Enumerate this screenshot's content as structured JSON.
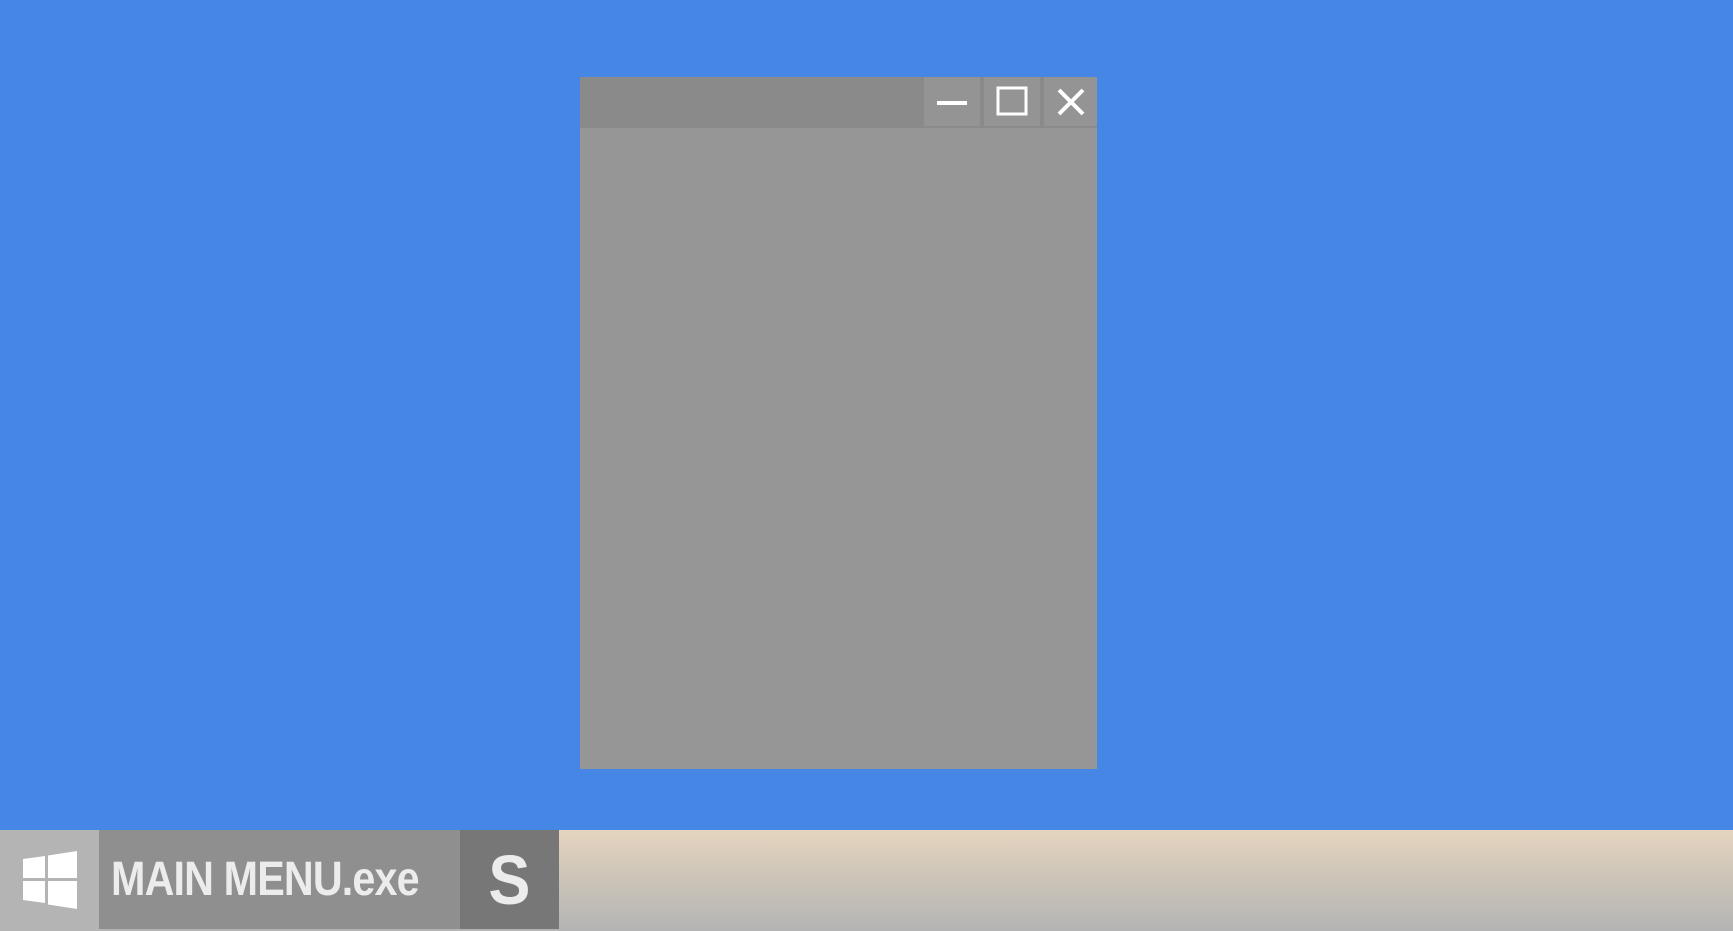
{
  "desktop": {
    "background_color": "#4687e6"
  },
  "window": {
    "title": "",
    "controls": {
      "minimize_icon": "minimize-icon",
      "maximize_icon": "maximize-icon",
      "close_icon": "close-icon"
    }
  },
  "taskbar": {
    "start_icon": "windows-logo-icon",
    "items": [
      {
        "label": "MAIN MENU.exe"
      },
      {
        "label": "S"
      }
    ]
  }
}
